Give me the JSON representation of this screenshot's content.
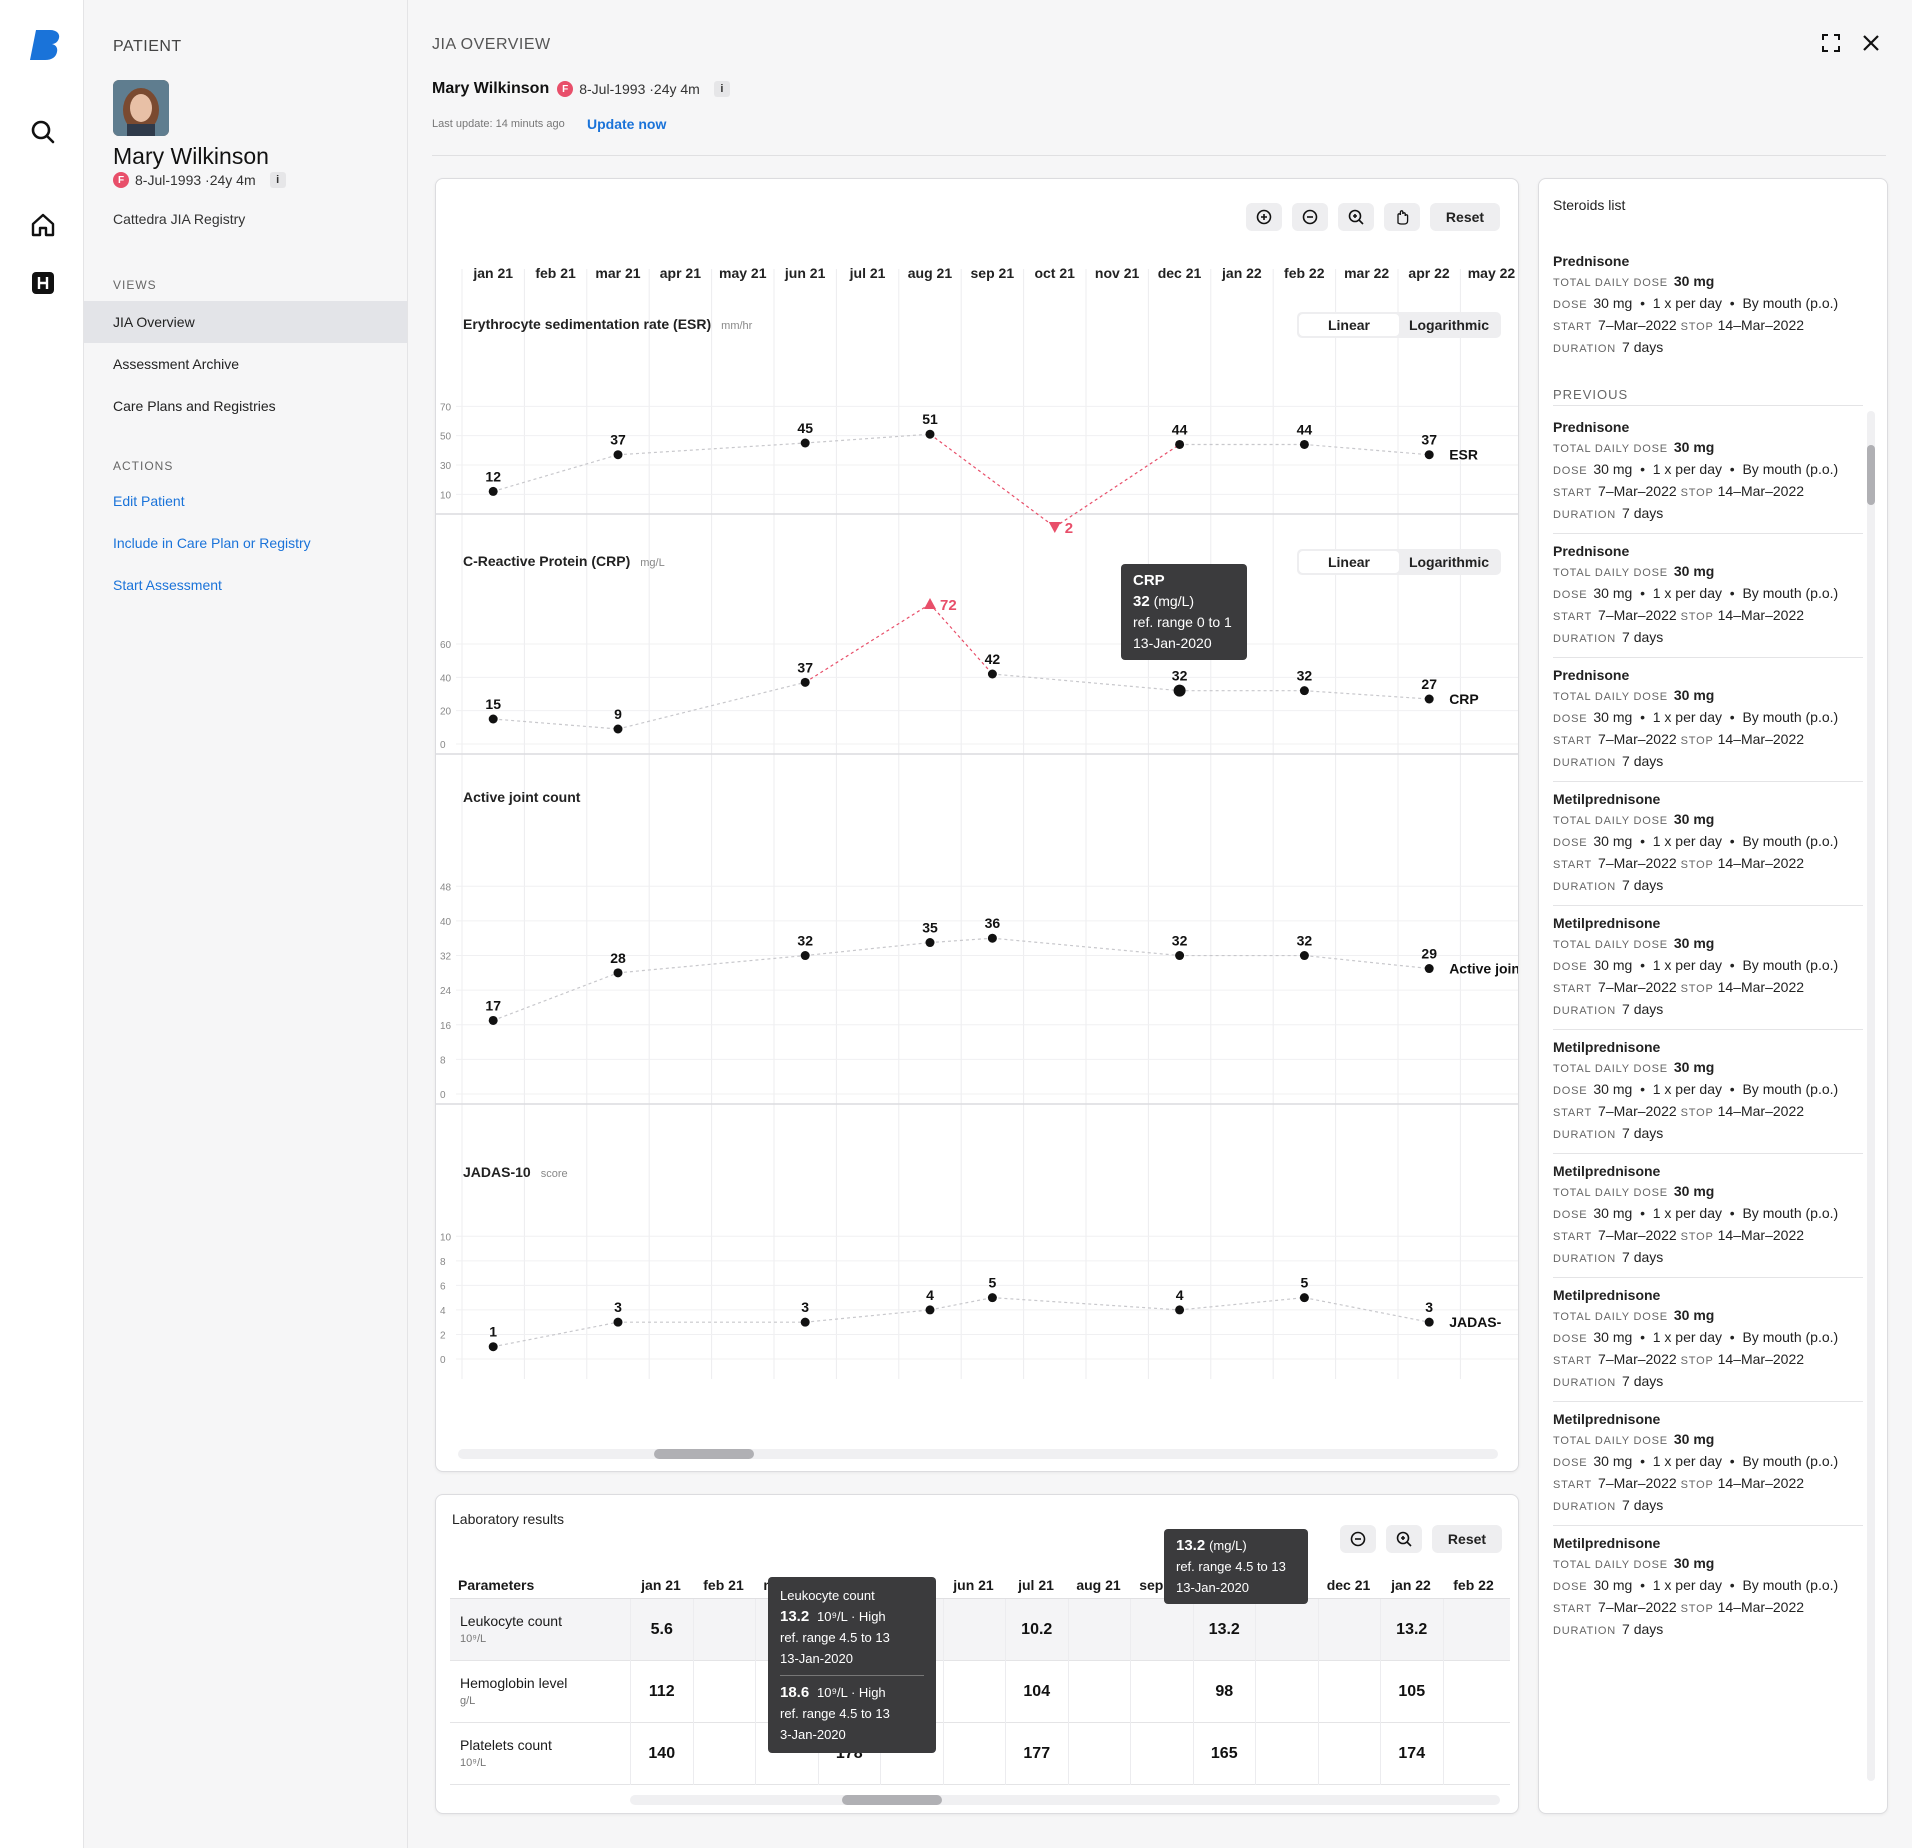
{
  "sidebar": {
    "header": "PATIENT",
    "patient_name": "Mary Wilkinson",
    "sex_badge": "F",
    "dob_age": "8-Jul-1993 ·24y 4m",
    "info_badge": "i",
    "registry": "Cattedra JIA Registry",
    "views_header": "VIEWS",
    "views": [
      "JIA Overview",
      "Assessment Archive",
      "Care Plans and Registries"
    ],
    "actions_header": "ACTIONS",
    "actions": [
      "Edit Patient",
      "Include in Care Plan or Registry",
      "Start Assessment"
    ]
  },
  "iconbar": {
    "icons": [
      "brand-logo-icon",
      "search-icon",
      "home-icon",
      "h-square-icon"
    ]
  },
  "main": {
    "title": "JIA OVERVIEW",
    "patient_name": "Mary Wilkinson",
    "sex_badge": "F",
    "dob_age": "8-Jul-1993 ·24y 4m",
    "info_badge": "i",
    "last_update": "Last update: 14 minuts ago",
    "update_now": "Update now"
  },
  "chart_toolbar": {
    "reset": "Reset",
    "icons": [
      "zoom-in-icon",
      "zoom-out-icon",
      "magnify-icon",
      "pan-hand-icon"
    ]
  },
  "months": [
    "jan 21",
    "feb 21",
    "mar 21",
    "apr 21",
    "may 21",
    "jun 21",
    "jul 21",
    "aug 21",
    "sep 21",
    "oct 21",
    "nov 21",
    "dec 21",
    "jan 22",
    "feb 22",
    "mar 22",
    "apr 22",
    "may 22"
  ],
  "scale_toggle": {
    "linear": "Linear",
    "logarithmic": "Logarithmic"
  },
  "chart_data": [
    {
      "type": "line",
      "title": "Erythrocyte sedimentation rate (ESR)",
      "unit": "mm/hr",
      "series_label": "ESR",
      "x": [
        "jan 21",
        "mar 21",
        "jun 21",
        "aug 21",
        "oct 21",
        "dec 21",
        "feb 22",
        "apr 22"
      ],
      "values": [
        12,
        37,
        45,
        51,
        2,
        44,
        44,
        37
      ],
      "yticks": [
        70,
        50,
        30,
        10
      ],
      "out_of_range": [
        {
          "x": "oct 21",
          "value": 2,
          "direction": "below"
        }
      ]
    },
    {
      "type": "line",
      "title": "C-Reactive Protein (CRP)",
      "unit": "mg/L",
      "series_label": "CRP",
      "x": [
        "jan 21",
        "mar 21",
        "jun 21",
        "aug 21",
        "sep 21",
        "dec 21",
        "feb 22",
        "apr 22"
      ],
      "values": [
        15,
        9,
        37,
        72,
        42,
        32,
        32,
        27
      ],
      "yticks": [
        60,
        40,
        20,
        0
      ],
      "out_of_range": [
        {
          "x": "aug 21",
          "value": 72,
          "direction": "above"
        }
      ]
    },
    {
      "type": "line",
      "title": "Active joint count",
      "unit": "",
      "series_label": "Active join",
      "x": [
        "jan 21",
        "mar 21",
        "jun 21",
        "aug 21",
        "sep 21",
        "dec 21",
        "feb 22",
        "apr 22"
      ],
      "values": [
        17,
        28,
        32,
        35,
        36,
        32,
        32,
        29
      ],
      "yticks": [
        48,
        40,
        32,
        24,
        16,
        8,
        0
      ]
    },
    {
      "type": "line",
      "title": "JADAS-10",
      "unit": "score",
      "series_label": "JADAS-",
      "x": [
        "jan 21",
        "mar 21",
        "jun 21",
        "aug 21",
        "sep 21",
        "dec 21",
        "feb 22",
        "apr 22"
      ],
      "values": [
        1,
        3,
        3,
        4,
        5,
        4,
        5,
        3
      ],
      "yticks": [
        10,
        8,
        6,
        4,
        2,
        0
      ]
    }
  ],
  "crp_tooltip": {
    "title": "CRP",
    "value": "32",
    "unit": "(mg/L)",
    "ref": "ref. range 0 to 1",
    "date": "13-Jan-2020"
  },
  "lab": {
    "title": "Laboratory results",
    "reset": "Reset",
    "param_header": "Parameters",
    "columns": [
      "jan 21",
      "feb 21",
      "mar 21",
      "apr 21",
      "may 21",
      "jun 21",
      "jul 21",
      "aug 21",
      "sep 21",
      "oct 21",
      "nov 21",
      "dec 21",
      "jan 22",
      "feb 22"
    ],
    "rows": [
      {
        "name": "Leukocyte count",
        "unit": "10⁹/L",
        "values": {
          "jan 21": "5.6",
          "jul 21": "10.2",
          "oct 21": "13.2",
          "jan 22": "13.2"
        }
      },
      {
        "name": "Hemoglobin level",
        "unit": "g/L",
        "values": {
          "jan 21": "112",
          "jul 21": "104",
          "oct 21": "98",
          "jan 22": "105"
        }
      },
      {
        "name": "Platelets count",
        "unit": "10⁹/L",
        "values": {
          "jan 21": "140",
          "apr 21": "178",
          "jul 21": "177",
          "oct 21": "165",
          "jan 22": "174"
        }
      }
    ],
    "tooltip_left": {
      "title": "Leukocyte count",
      "v1": "13.2",
      "u1": "10⁹/L · High",
      "r1": "ref. range 4.5 to 13",
      "d1": "13-Jan-2020",
      "v2": "18.6",
      "u2": "10⁹/L · High",
      "r2": "ref. range 4.5 to 13",
      "d2": "3-Jan-2020"
    },
    "tooltip_right": {
      "v": "13.2",
      "u": "(mg/L)",
      "r": "ref. range 4.5 to 13",
      "d": "13-Jan-2020"
    }
  },
  "steroids": {
    "title": "Steroids list",
    "previous_header": "PREVIOUS",
    "labels": {
      "total": "TOTAL DAILY DOSE",
      "dose": "DOSE",
      "start": "START",
      "stop": "STOP",
      "duration": "DURATION"
    },
    "current": {
      "name": "Prednisone",
      "total": "30 mg",
      "dose": "30 mg  •  1 x per day  •  By mouth (p.o.)",
      "start": "7–Mar–2022",
      "stop": "14–Mar–2022",
      "duration": "7 days"
    },
    "previous": [
      {
        "name": "Prednisone",
        "total": "30 mg",
        "dose": "30 mg  •  1 x per day  •  By mouth (p.o.)",
        "start": "7–Mar–2022",
        "stop": "14–Mar–2022",
        "duration": "7 days"
      },
      {
        "name": "Prednisone",
        "total": "30 mg",
        "dose": "30 mg  •  1 x per day  •  By mouth (p.o.)",
        "start": "7–Mar–2022",
        "stop": "14–Mar–2022",
        "duration": "7 days"
      },
      {
        "name": "Prednisone",
        "total": "30 mg",
        "dose": "30 mg  •  1 x per day  •  By mouth (p.o.)",
        "start": "7–Mar–2022",
        "stop": "14–Mar–2022",
        "duration": "7 days"
      },
      {
        "name": "Metilprednisone",
        "total": "30 mg",
        "dose": "30 mg  •  1 x per day  •  By mouth (p.o.)",
        "start": "7–Mar–2022",
        "stop": "14–Mar–2022",
        "duration": "7 days"
      },
      {
        "name": "Metilprednisone",
        "total": "30 mg",
        "dose": "30 mg  •  1 x per day  •  By mouth (p.o.)",
        "start": "7–Mar–2022",
        "stop": "14–Mar–2022",
        "duration": "7 days"
      },
      {
        "name": "Metilprednisone",
        "total": "30 mg",
        "dose": "30 mg  •  1 x per day  •  By mouth (p.o.)",
        "start": "7–Mar–2022",
        "stop": "14–Mar–2022",
        "duration": "7 days"
      },
      {
        "name": "Metilprednisone",
        "total": "30 mg",
        "dose": "30 mg  •  1 x per day  •  By mouth (p.o.)",
        "start": "7–Mar–2022",
        "stop": "14–Mar–2022",
        "duration": "7 days"
      },
      {
        "name": "Metilprednisone",
        "total": "30 mg",
        "dose": "30 mg  •  1 x per day  •  By mouth (p.o.)",
        "start": "7–Mar–2022",
        "stop": "14–Mar–2022",
        "duration": "7 days"
      },
      {
        "name": "Metilprednisone",
        "total": "30 mg",
        "dose": "30 mg  •  1 x per day  •  By mouth (p.o.)",
        "start": "7–Mar–2022",
        "stop": "14–Mar–2022",
        "duration": "7 days"
      },
      {
        "name": "Metilprednisone",
        "total": "30 mg",
        "dose": "30 mg  •  1 x per day  •  By mouth (p.o.)",
        "start": "7–Mar–2022",
        "stop": "14–Mar–2022",
        "duration": "7 days"
      }
    ]
  },
  "colors": {
    "accent": "#1a73d9",
    "alert": "#e84f6a",
    "tooltip": "#3b3b3d"
  }
}
